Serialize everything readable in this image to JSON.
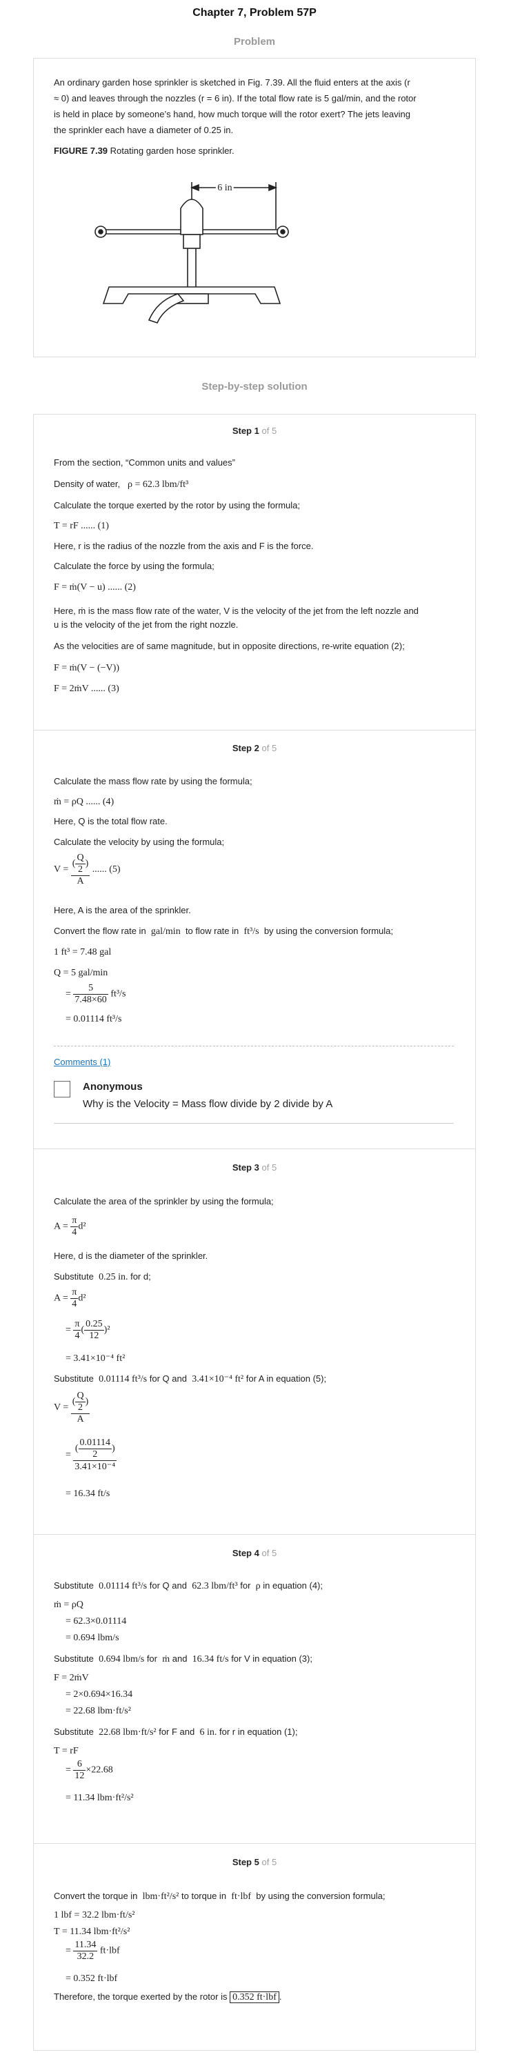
{
  "header": {
    "title": "Chapter 7, Problem 57P",
    "problem_heading": "Problem",
    "solution_heading": "Step-by-step solution"
  },
  "problem": {
    "lines": [
      "An ordinary garden hose sprinkler is sketched in Fig. 7.39. All the fluid enters at the axis (r",
      "≈ 0) and leaves through the nozzles (r = 6 in). If the total flow rate is 5 gal/min, and the rotor",
      "is held in place by someone’s hand, how much torque will the rotor exert? The jets leaving",
      "the sprinkler each have a diameter of 0.25 in."
    ],
    "figure_label": "FIGURE 7.39",
    "figure_caption": "Rotating garden hose sprinkler.",
    "figure_dim": "6 in"
  },
  "step_label": "Step",
  "of_label": "of 5",
  "steps": [
    {
      "n": "1",
      "lines": [
        "From the section, “Common units and values”",
        "Density of water,",
        "ρ = 62.3 lbm/ft³",
        "Calculate the torque exerted by the rotor by using the formula;",
        "T = rF ...... (1)",
        "Here, r is the radius of the nozzle from the axis and F is the force.",
        "Calculate the force by using the formula;",
        "F = ṁ(V − u) ...... (2)",
        "Here, ṁ is the mass flow rate of the water, V is the velocity of the jet from the left nozzle and",
        "u is the velocity of the jet from the right nozzle.",
        "As the velocities are of same magnitude, but in opposite directions, re-write equation (2);",
        "F = ṁ(V − (−V))",
        "F = 2ṁV ...... (3)"
      ]
    },
    {
      "n": "2",
      "lines": [
        "Calculate the mass flow rate by using the formula;",
        "ṁ = ρQ ...... (4)",
        "Here, Q is the total flow rate.",
        "Calculate the velocity by using the formula;",
        "V =",
        "Q",
        "2",
        "A",
        "...... (5)",
        "Here, A is the area of the sprinkler.",
        "Convert the flow rate in",
        "gal/min",
        "to flow rate in",
        "ft³/s",
        "by using the conversion formula;",
        "1 ft³ = 7.48 gal",
        "Q = 5 gal/min",
        "5",
        "7.48×60",
        "ft³/s",
        "= 0.01114 ft³/s"
      ],
      "comments_link": "Comments (1)",
      "comment_author": "Anonymous",
      "comment_text": "Why is the Velocity = Mass flow divide by 2 divide by A"
    },
    {
      "n": "3",
      "lines": [
        "Calculate the area of the sprinkler by using the formula;",
        "A =",
        "π",
        "4",
        "d²",
        "Here, d is the diameter of the sprinkler.",
        "Substitute",
        "0.25 in.",
        "for d;",
        "0.25",
        "12",
        "= 3.41×10⁻⁴ ft²",
        "0.01114 ft³/s",
        "for Q and",
        "3.41×10⁻⁴ ft²",
        "for A in equation (5);",
        "0.01114",
        "3.41×10⁻⁴",
        "= 16.34 ft/s"
      ]
    },
    {
      "n": "4",
      "lines": [
        "0.01114 ft³/s",
        "62.3 lbm/ft³",
        "for",
        "ρ",
        "in equation (4);",
        "ṁ = ρQ",
        "= 62.3×0.01114",
        "= 0.694 lbm/s",
        "0.694 lbm/s",
        "ṁ",
        "and",
        "16.34 ft/s",
        "for V in equation (3);",
        "F = 2ṁV",
        "= 2×0.694×16.34",
        "= 22.68 lbm·ft/s²",
        "22.68 lbm·ft/s²",
        "for F and",
        "6 in.",
        "for r in equation (1);",
        "T = rF",
        "6",
        "×22.68",
        "= 11.34 lbm·ft²/s²"
      ]
    },
    {
      "n": "5",
      "lines": [
        "Convert the torque in",
        "lbm·ft²/s²",
        "to torque in",
        "ft·lbf",
        "by using the conversion formula;",
        "1 lbf = 32.2 lbm·ft/s²",
        "T = 11.34 lbm·ft²/s²",
        "11.34",
        "32.2",
        "ft·lbf",
        "= 0.352 ft·lbf",
        "Therefore, the torque exerted by the rotor is",
        "0.352 ft·lbf"
      ]
    }
  ]
}
